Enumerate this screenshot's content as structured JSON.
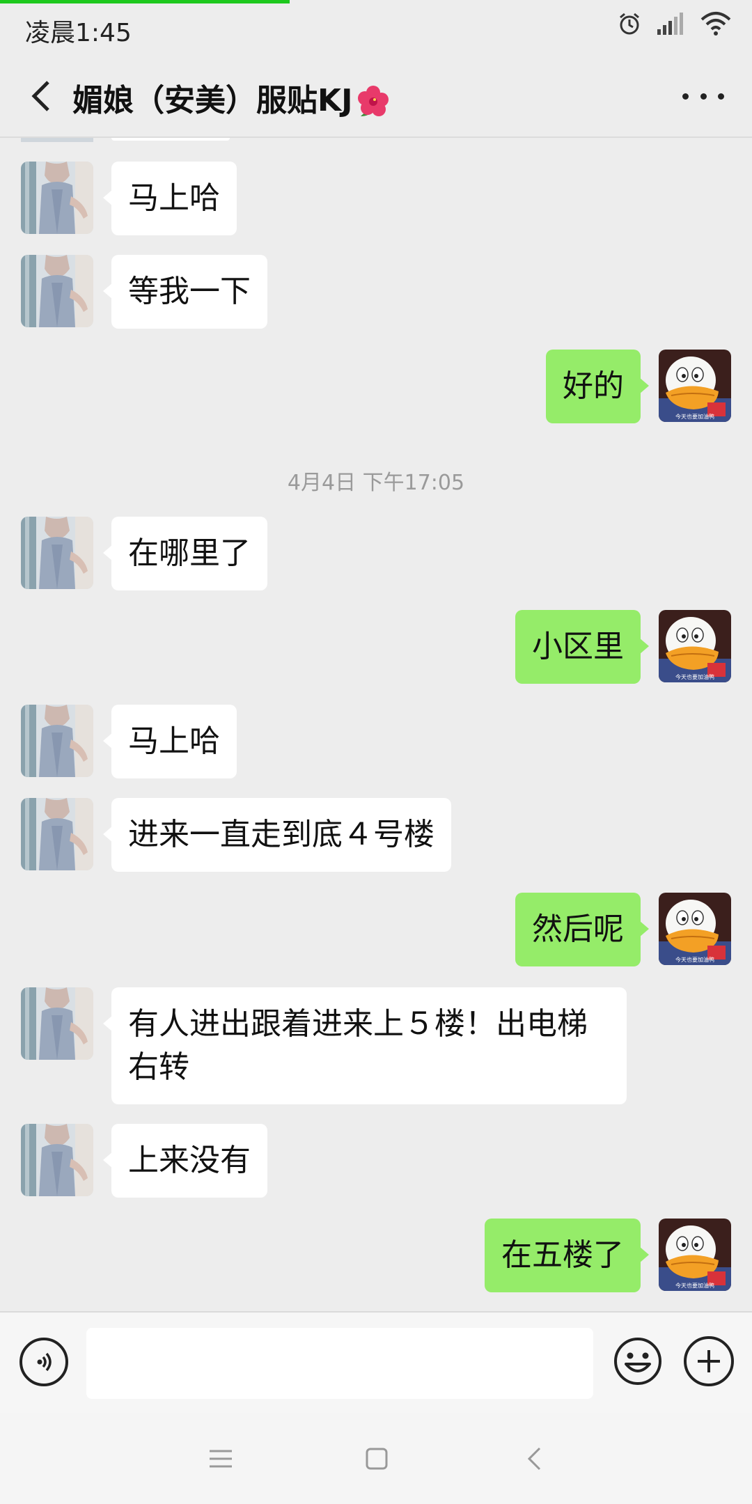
{
  "status_bar": {
    "time": "凌晨1:45",
    "progress": 0.385
  },
  "header": {
    "title": "媚娘（安美）服贴KJ"
  },
  "messages": [
    {
      "side": "left",
      "text": "马上哈"
    },
    {
      "side": "left",
      "text": "等我一下"
    },
    {
      "side": "right",
      "text": "好的"
    },
    {
      "side": "left",
      "text": "在哪里了"
    },
    {
      "side": "right",
      "text": "小区里"
    },
    {
      "side": "left",
      "text": "马上哈"
    },
    {
      "side": "left",
      "text": "进来一直走到底４号楼"
    },
    {
      "side": "right",
      "text": "然后呢"
    },
    {
      "side": "left",
      "text": "有人进出跟着进来上５楼！出电梯右转"
    },
    {
      "side": "left",
      "text": "上来没有"
    },
    {
      "side": "right",
      "text": "在五楼了"
    }
  ],
  "timestamp": "4月4日 下午17:05",
  "avatar_right_caption": "今天也要加油鸭",
  "input": {
    "value": "",
    "placeholder": ""
  },
  "colors": {
    "sent_bubble": "#95ec69",
    "received_bubble": "#ffffff",
    "background": "#ededed",
    "progress": "#1ec91e"
  },
  "icons": {
    "back": "back-arrow-icon",
    "more": "more-dots-icon",
    "voice": "voice-icon",
    "emoji": "emoji-icon",
    "plus": "plus-icon",
    "alarm": "alarm-icon",
    "signal": "signal-icon",
    "wifi": "wifi-icon",
    "title_emoji": "hibiscus-icon"
  }
}
